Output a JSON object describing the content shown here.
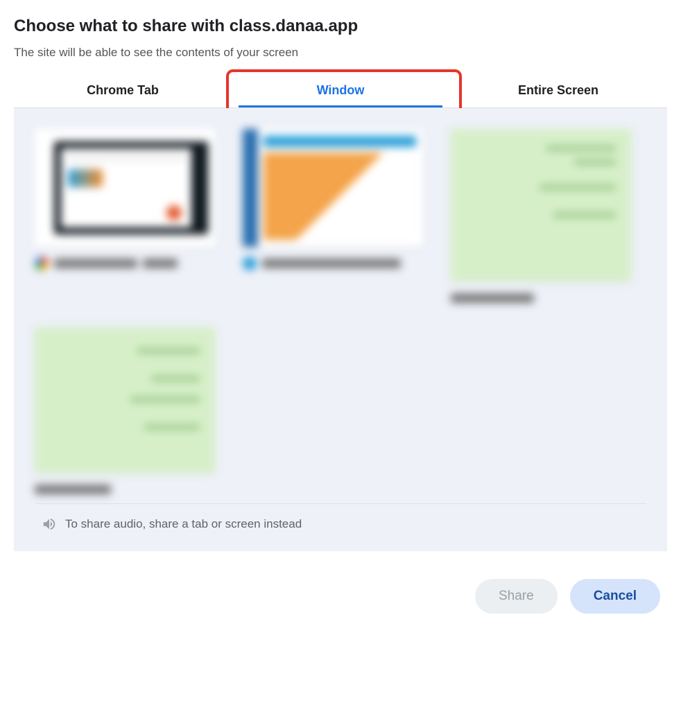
{
  "dialog": {
    "title": "Choose what to share with class.danaa.app",
    "subtitle": "The site will be able to see the contents of your screen"
  },
  "tabs": {
    "chrome_tab": "Chrome Tab",
    "window": "Window",
    "entire_screen": "Entire Screen",
    "active": "window"
  },
  "audio_hint": "To share audio, share a tab or screen instead",
  "buttons": {
    "share": "Share",
    "cancel": "Cancel"
  }
}
